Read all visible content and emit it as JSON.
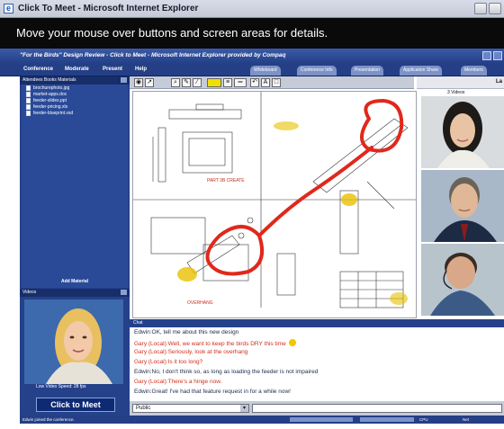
{
  "window": {
    "title": "Click To Meet - Microsoft Internet Explorer"
  },
  "tip_banner": {
    "text": "Move your mouse over buttons and screen areas for details."
  },
  "app": {
    "title": "\"For the Birds\" Design Review - Click to Meet - Microsoft Internet Explorer provided by Compaq"
  },
  "menu": {
    "items": [
      "Conference",
      "Moderate",
      "Present",
      "Help"
    ],
    "tabs": [
      "Whiteboard",
      "Conference Info",
      "Presentation",
      "Application Share",
      "Members"
    ]
  },
  "sidebar": {
    "panel_header": "Attendees  Books  Materials",
    "files": [
      "brochurephoto.jpg",
      "market-apps.doc",
      "feeder-slides.ppt",
      "feeder-pricing.xls",
      "feeder-blueprint.vsd"
    ],
    "add_material_label": "Add Material",
    "videos_header": "Videos",
    "video_speed_label": "Low Video Speed: 28 fps",
    "logo_text": "Click to Meet"
  },
  "right_panel": {
    "header_label": "La",
    "videos_count_label": "3 Videos"
  },
  "chat": {
    "header": "Chat",
    "messages": [
      {
        "text": "Edwin:OK, tell me about this new design",
        "sender_type": "remote"
      },
      {
        "text": "Gary (Local):Well, we want to keep the birds DRY this time",
        "sender_type": "local",
        "emoticon": "smiley"
      },
      {
        "text": "Gary (Local):Seriously, look at the overhang",
        "sender_type": "local"
      },
      {
        "text": "Gary (Local):Is it too long?",
        "sender_type": "local"
      },
      {
        "text": "Edwin:No, I don't think so, as long as loading the feeder is not impaired",
        "sender_type": "remote"
      },
      {
        "text": "Gary (Local):There's a hinge now.",
        "sender_type": "local"
      },
      {
        "text": "Edwin:Great! I've had that feature request in for a while now!",
        "sender_type": "remote"
      }
    ],
    "recipient_selected": "Public"
  },
  "status": {
    "message": "Edwin joined the conference.",
    "cpu_label": "CPU",
    "net_label": "Net"
  },
  "colors": {
    "app_blue": "#24418a",
    "tip_black": "#0a0a0a",
    "local_chat": "#d2301e",
    "annotation_red": "#e0281c",
    "highlight_yellow": "#f5e61c"
  }
}
